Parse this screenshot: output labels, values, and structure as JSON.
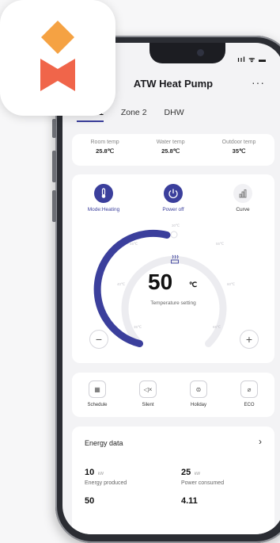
{
  "app": {
    "title": "ATW Heat Pump",
    "more_label": "···"
  },
  "status": {
    "icons": "ııl ᯤ ▬"
  },
  "tabs": [
    {
      "label": "Zone 1",
      "active": true
    },
    {
      "label": "Zone 2",
      "active": false
    },
    {
      "label": "DHW",
      "active": false
    }
  ],
  "temps": [
    {
      "label": "Room temp",
      "value": "25.8℃"
    },
    {
      "label": "Water temp",
      "value": "25.8℃"
    },
    {
      "label": "Outdoor temp",
      "value": "35℃"
    }
  ],
  "controls": {
    "mode": {
      "label": "Mode:Heating",
      "icon": "thermometer-icon"
    },
    "power": {
      "label": "Power off",
      "icon": "power-icon"
    },
    "curve": {
      "label": "Curve",
      "icon": "chart-icon"
    }
  },
  "dial": {
    "value": "50",
    "unit": "℃",
    "label": "Temperature setting",
    "ticks": [
      "30℃",
      "45℃",
      "55℃",
      "40℃",
      "60℃",
      "35℃",
      "65℃"
    ],
    "accent": "#3b3f9c",
    "minus": "−",
    "plus": "+"
  },
  "modes": [
    {
      "label": "Schedule",
      "icon": "calendar-icon",
      "glyph": "▦"
    },
    {
      "label": "Silent",
      "icon": "speaker-mute-icon",
      "glyph": "◁×"
    },
    {
      "label": "Holiday",
      "icon": "suitcase-icon",
      "glyph": "⊜"
    },
    {
      "label": "ECO",
      "icon": "leaf-icon",
      "glyph": "⌀"
    }
  ],
  "energy": {
    "title": "Energy data",
    "arrow": "›",
    "produced": {
      "value": "10",
      "unit": "kW",
      "label": "Energy produced"
    },
    "consumed": {
      "value": "25",
      "unit": "kW",
      "label": "Power consumed"
    },
    "row3_left": "50",
    "row3_right": "4.11"
  }
}
